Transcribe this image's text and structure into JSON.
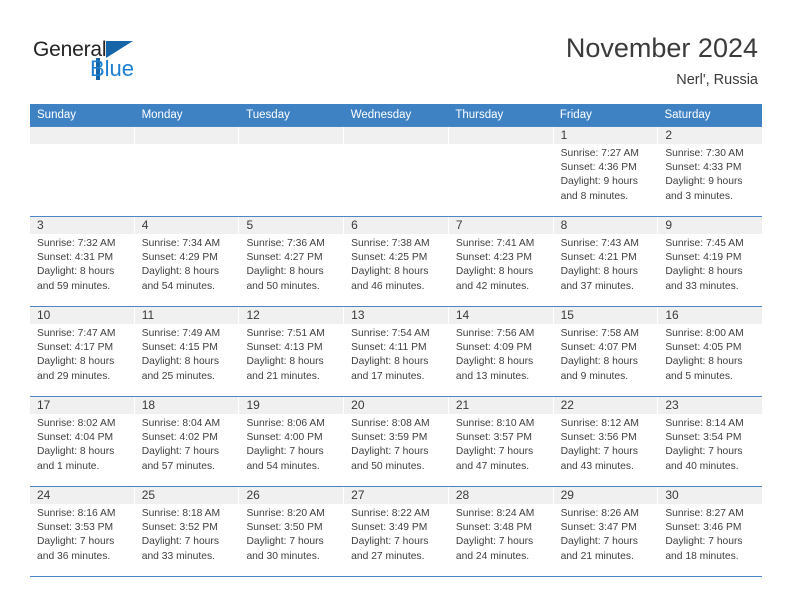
{
  "brand": {
    "logo_top": "General",
    "logo_bottom": "Blue",
    "accent_color": "#1d7fd1",
    "logo_mark": "triangle-icon"
  },
  "header": {
    "title": "November 2024",
    "subtitle": "Nerl', Russia"
  },
  "theme": {
    "header_bg": "#3f82c4",
    "header_text": "#ffffff",
    "daynum_bg": "#f0f0f0",
    "grid_line": "#4a86c8",
    "body_text": "#3f3f3f"
  },
  "weekdays": [
    "Sunday",
    "Monday",
    "Tuesday",
    "Wednesday",
    "Thursday",
    "Friday",
    "Saturday"
  ],
  "weeks": [
    [
      {
        "day": "",
        "sunrise": "",
        "sunset": "",
        "daylight1": "",
        "daylight2": "",
        "empty": true
      },
      {
        "day": "",
        "sunrise": "",
        "sunset": "",
        "daylight1": "",
        "daylight2": "",
        "empty": true
      },
      {
        "day": "",
        "sunrise": "",
        "sunset": "",
        "daylight1": "",
        "daylight2": "",
        "empty": true
      },
      {
        "day": "",
        "sunrise": "",
        "sunset": "",
        "daylight1": "",
        "daylight2": "",
        "empty": true
      },
      {
        "day": "",
        "sunrise": "",
        "sunset": "",
        "daylight1": "",
        "daylight2": "",
        "empty": true
      },
      {
        "day": "1",
        "sunrise": "Sunrise: 7:27 AM",
        "sunset": "Sunset: 4:36 PM",
        "daylight1": "Daylight: 9 hours",
        "daylight2": "and 8 minutes."
      },
      {
        "day": "2",
        "sunrise": "Sunrise: 7:30 AM",
        "sunset": "Sunset: 4:33 PM",
        "daylight1": "Daylight: 9 hours",
        "daylight2": "and 3 minutes."
      }
    ],
    [
      {
        "day": "3",
        "sunrise": "Sunrise: 7:32 AM",
        "sunset": "Sunset: 4:31 PM",
        "daylight1": "Daylight: 8 hours",
        "daylight2": "and 59 minutes."
      },
      {
        "day": "4",
        "sunrise": "Sunrise: 7:34 AM",
        "sunset": "Sunset: 4:29 PM",
        "daylight1": "Daylight: 8 hours",
        "daylight2": "and 54 minutes."
      },
      {
        "day": "5",
        "sunrise": "Sunrise: 7:36 AM",
        "sunset": "Sunset: 4:27 PM",
        "daylight1": "Daylight: 8 hours",
        "daylight2": "and 50 minutes."
      },
      {
        "day": "6",
        "sunrise": "Sunrise: 7:38 AM",
        "sunset": "Sunset: 4:25 PM",
        "daylight1": "Daylight: 8 hours",
        "daylight2": "and 46 minutes."
      },
      {
        "day": "7",
        "sunrise": "Sunrise: 7:41 AM",
        "sunset": "Sunset: 4:23 PM",
        "daylight1": "Daylight: 8 hours",
        "daylight2": "and 42 minutes."
      },
      {
        "day": "8",
        "sunrise": "Sunrise: 7:43 AM",
        "sunset": "Sunset: 4:21 PM",
        "daylight1": "Daylight: 8 hours",
        "daylight2": "and 37 minutes."
      },
      {
        "day": "9",
        "sunrise": "Sunrise: 7:45 AM",
        "sunset": "Sunset: 4:19 PM",
        "daylight1": "Daylight: 8 hours",
        "daylight2": "and 33 minutes."
      }
    ],
    [
      {
        "day": "10",
        "sunrise": "Sunrise: 7:47 AM",
        "sunset": "Sunset: 4:17 PM",
        "daylight1": "Daylight: 8 hours",
        "daylight2": "and 29 minutes."
      },
      {
        "day": "11",
        "sunrise": "Sunrise: 7:49 AM",
        "sunset": "Sunset: 4:15 PM",
        "daylight1": "Daylight: 8 hours",
        "daylight2": "and 25 minutes."
      },
      {
        "day": "12",
        "sunrise": "Sunrise: 7:51 AM",
        "sunset": "Sunset: 4:13 PM",
        "daylight1": "Daylight: 8 hours",
        "daylight2": "and 21 minutes."
      },
      {
        "day": "13",
        "sunrise": "Sunrise: 7:54 AM",
        "sunset": "Sunset: 4:11 PM",
        "daylight1": "Daylight: 8 hours",
        "daylight2": "and 17 minutes."
      },
      {
        "day": "14",
        "sunrise": "Sunrise: 7:56 AM",
        "sunset": "Sunset: 4:09 PM",
        "daylight1": "Daylight: 8 hours",
        "daylight2": "and 13 minutes."
      },
      {
        "day": "15",
        "sunrise": "Sunrise: 7:58 AM",
        "sunset": "Sunset: 4:07 PM",
        "daylight1": "Daylight: 8 hours",
        "daylight2": "and 9 minutes."
      },
      {
        "day": "16",
        "sunrise": "Sunrise: 8:00 AM",
        "sunset": "Sunset: 4:05 PM",
        "daylight1": "Daylight: 8 hours",
        "daylight2": "and 5 minutes."
      }
    ],
    [
      {
        "day": "17",
        "sunrise": "Sunrise: 8:02 AM",
        "sunset": "Sunset: 4:04 PM",
        "daylight1": "Daylight: 8 hours",
        "daylight2": "and 1 minute."
      },
      {
        "day": "18",
        "sunrise": "Sunrise: 8:04 AM",
        "sunset": "Sunset: 4:02 PM",
        "daylight1": "Daylight: 7 hours",
        "daylight2": "and 57 minutes."
      },
      {
        "day": "19",
        "sunrise": "Sunrise: 8:06 AM",
        "sunset": "Sunset: 4:00 PM",
        "daylight1": "Daylight: 7 hours",
        "daylight2": "and 54 minutes."
      },
      {
        "day": "20",
        "sunrise": "Sunrise: 8:08 AM",
        "sunset": "Sunset: 3:59 PM",
        "daylight1": "Daylight: 7 hours",
        "daylight2": "and 50 minutes."
      },
      {
        "day": "21",
        "sunrise": "Sunrise: 8:10 AM",
        "sunset": "Sunset: 3:57 PM",
        "daylight1": "Daylight: 7 hours",
        "daylight2": "and 47 minutes."
      },
      {
        "day": "22",
        "sunrise": "Sunrise: 8:12 AM",
        "sunset": "Sunset: 3:56 PM",
        "daylight1": "Daylight: 7 hours",
        "daylight2": "and 43 minutes."
      },
      {
        "day": "23",
        "sunrise": "Sunrise: 8:14 AM",
        "sunset": "Sunset: 3:54 PM",
        "daylight1": "Daylight: 7 hours",
        "daylight2": "and 40 minutes."
      }
    ],
    [
      {
        "day": "24",
        "sunrise": "Sunrise: 8:16 AM",
        "sunset": "Sunset: 3:53 PM",
        "daylight1": "Daylight: 7 hours",
        "daylight2": "and 36 minutes."
      },
      {
        "day": "25",
        "sunrise": "Sunrise: 8:18 AM",
        "sunset": "Sunset: 3:52 PM",
        "daylight1": "Daylight: 7 hours",
        "daylight2": "and 33 minutes."
      },
      {
        "day": "26",
        "sunrise": "Sunrise: 8:20 AM",
        "sunset": "Sunset: 3:50 PM",
        "daylight1": "Daylight: 7 hours",
        "daylight2": "and 30 minutes."
      },
      {
        "day": "27",
        "sunrise": "Sunrise: 8:22 AM",
        "sunset": "Sunset: 3:49 PM",
        "daylight1": "Daylight: 7 hours",
        "daylight2": "and 27 minutes."
      },
      {
        "day": "28",
        "sunrise": "Sunrise: 8:24 AM",
        "sunset": "Sunset: 3:48 PM",
        "daylight1": "Daylight: 7 hours",
        "daylight2": "and 24 minutes."
      },
      {
        "day": "29",
        "sunrise": "Sunrise: 8:26 AM",
        "sunset": "Sunset: 3:47 PM",
        "daylight1": "Daylight: 7 hours",
        "daylight2": "and 21 minutes."
      },
      {
        "day": "30",
        "sunrise": "Sunrise: 8:27 AM",
        "sunset": "Sunset: 3:46 PM",
        "daylight1": "Daylight: 7 hours",
        "daylight2": "and 18 minutes."
      }
    ]
  ]
}
